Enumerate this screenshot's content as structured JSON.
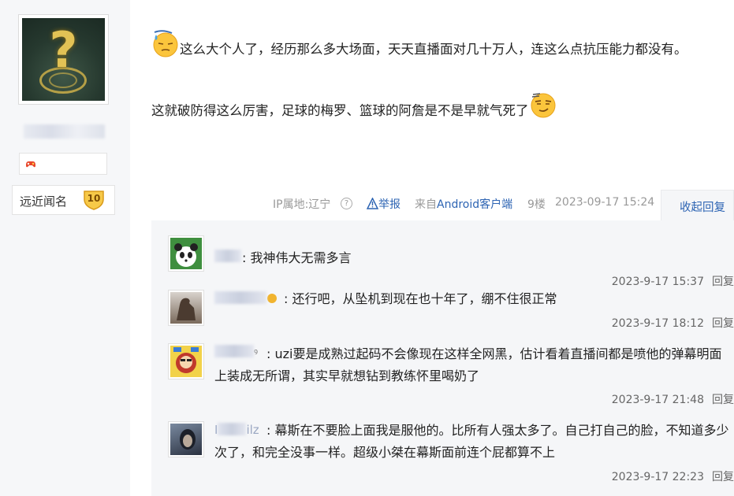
{
  "sidebar": {
    "avatar": "question-mark-ward-avatar",
    "badge_icon": "game-controller-icon",
    "level_name": "远近闻名",
    "level_number": "10"
  },
  "post": {
    "para1": "这么大个人了，经历那么多大场面，天天直播面对几十万人，连这么点抗压能力都没有。",
    "para2": "这就破防得这么厉害，足球的梅罗、篮球的阿詹是不是早就气死了",
    "emoji1": "sweat-emoji",
    "emoji2": "smug-emoji"
  },
  "meta": {
    "ip": "IP属地:辽宁",
    "report": "举报",
    "client_prefix": "来自",
    "client": "Android客户端",
    "floor": "9楼",
    "time": "2023-09-17 15:24",
    "collapse": "收起回复"
  },
  "replies": [
    {
      "user_visible": "",
      "text": "我神伟大无需多言",
      "time": "2023-9-17 15:37",
      "reply": "回复",
      "avatar_color": "#3f8f3f"
    },
    {
      "user_visible": "",
      "text": "还行吧，从坠机到现在也十年了，绷不住很正常",
      "time": "2023-9-17 18:12",
      "reply": "回复",
      "avatar_color": "#7a6a5c"
    },
    {
      "user_visible": "",
      "text": "uzi要是成熟过起码不会像现在这样全网黑，估计看着直播间都是喷他的弹幕明面上装成无所谓，其实早就想钻到教练怀里喝奶了",
      "time": "2023-9-17 21:48",
      "reply": "回复",
      "avatar_color": "#c0392b"
    },
    {
      "user_visible": "ilz",
      "text": "幕斯在不要脸上面我是服他的。比所有人强太多了。自己打自己的脸，不知道多少次了，和完全没事一样。超级小桀在幕斯面前连个屁都算不上",
      "time": "2023-9-17 22:23",
      "reply": "回复",
      "avatar_color": "#3a4252"
    }
  ],
  "colors": {
    "link": "#2d64b3",
    "reply_bg": "#f5f6f8",
    "sidebar_bg": "#f6f7f9"
  }
}
